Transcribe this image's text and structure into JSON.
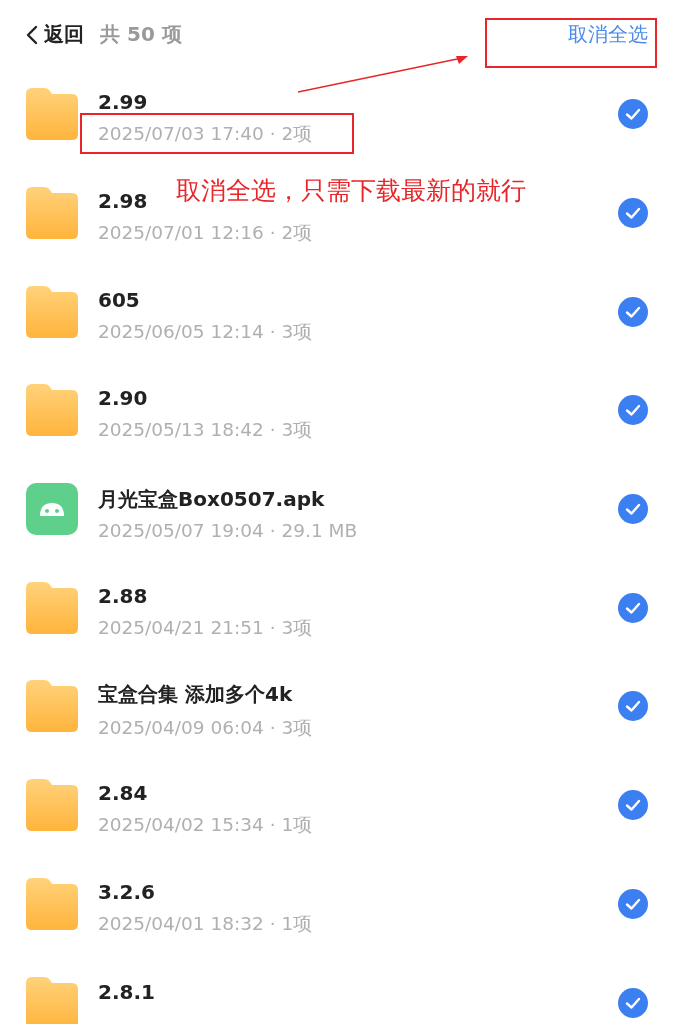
{
  "header": {
    "back_label": "返回",
    "count": "共 50 项",
    "action": "取消全选"
  },
  "items": [
    {
      "kind": "folder",
      "name": "2.99",
      "meta": "2025/07/03 17:40 · 2项",
      "selected": true
    },
    {
      "kind": "folder",
      "name": "2.98",
      "meta": "2025/07/01 12:16 · 2项",
      "selected": true
    },
    {
      "kind": "folder",
      "name": "605",
      "meta": "2025/06/05 12:14 · 3项",
      "selected": true
    },
    {
      "kind": "folder",
      "name": "2.90",
      "meta": "2025/05/13 18:42 · 3项",
      "selected": true
    },
    {
      "kind": "apk",
      "name": "月光宝盒Box0507.apk",
      "meta": "2025/05/07 19:04 · 29.1 MB",
      "selected": true
    },
    {
      "kind": "folder",
      "name": "2.88",
      "meta": "2025/04/21 21:51 · 3项",
      "selected": true
    },
    {
      "kind": "folder",
      "name": "宝盒合集 添加多个4k",
      "meta": "2025/04/09 06:04 · 3项",
      "selected": true
    },
    {
      "kind": "folder",
      "name": "2.84",
      "meta": "2025/04/02 15:34 · 1项",
      "selected": true
    },
    {
      "kind": "folder",
      "name": "3.2.6",
      "meta": "2025/04/01 18:32 · 1项",
      "selected": true
    },
    {
      "kind": "folder",
      "name": "2.8.1",
      "selected": true
    }
  ],
  "annotation": {
    "note": "取消全选，只需下载最新的就行"
  }
}
